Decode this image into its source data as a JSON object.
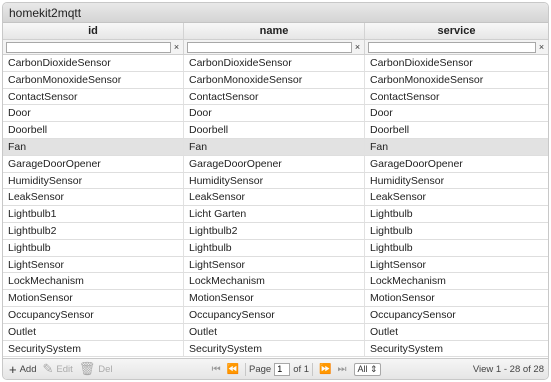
{
  "caption": "homekit2mqtt",
  "columns": [
    "id",
    "name",
    "service"
  ],
  "filter_clear": "×",
  "rows": [
    [
      "CarbonDioxideSensor",
      "CarbonDioxideSensor",
      "CarbonDioxideSensor"
    ],
    [
      "CarbonMonoxideSensor",
      "CarbonMonoxideSensor",
      "CarbonMonoxideSensor"
    ],
    [
      "ContactSensor",
      "ContactSensor",
      "ContactSensor"
    ],
    [
      "Door",
      "Door",
      "Door"
    ],
    [
      "Doorbell",
      "Doorbell",
      "Doorbell"
    ],
    [
      "Fan",
      "Fan",
      "Fan"
    ],
    [
      "GarageDoorOpener",
      "GarageDoorOpener",
      "GarageDoorOpener"
    ],
    [
      "HumiditySensor",
      "HumiditySensor",
      "HumiditySensor"
    ],
    [
      "LeakSensor",
      "LeakSensor",
      "LeakSensor"
    ],
    [
      "Lightbulb1",
      "Licht Garten",
      "Lightbulb"
    ],
    [
      "Lightbulb2",
      "Lightbulb2",
      "Lightbulb"
    ],
    [
      "Lightbulb",
      "Lightbulb",
      "Lightbulb"
    ],
    [
      "LightSensor",
      "LightSensor",
      "LightSensor"
    ],
    [
      "LockMechanism",
      "LockMechanism",
      "LockMechanism"
    ],
    [
      "MotionSensor",
      "MotionSensor",
      "MotionSensor"
    ],
    [
      "OccupancySensor",
      "OccupancySensor",
      "OccupancySensor"
    ],
    [
      "Outlet",
      "Outlet",
      "Outlet"
    ],
    [
      "SecuritySystem",
      "SecuritySystem",
      "SecuritySystem"
    ]
  ],
  "selected_row": 5,
  "pager": {
    "add_label": "Add",
    "edit_label": "Edit",
    "del_label": "Del",
    "page_label": "Page",
    "page_value": "1",
    "of_label": "of 1",
    "rows_select": "All",
    "view_text": "View 1 - 28 of 28"
  }
}
